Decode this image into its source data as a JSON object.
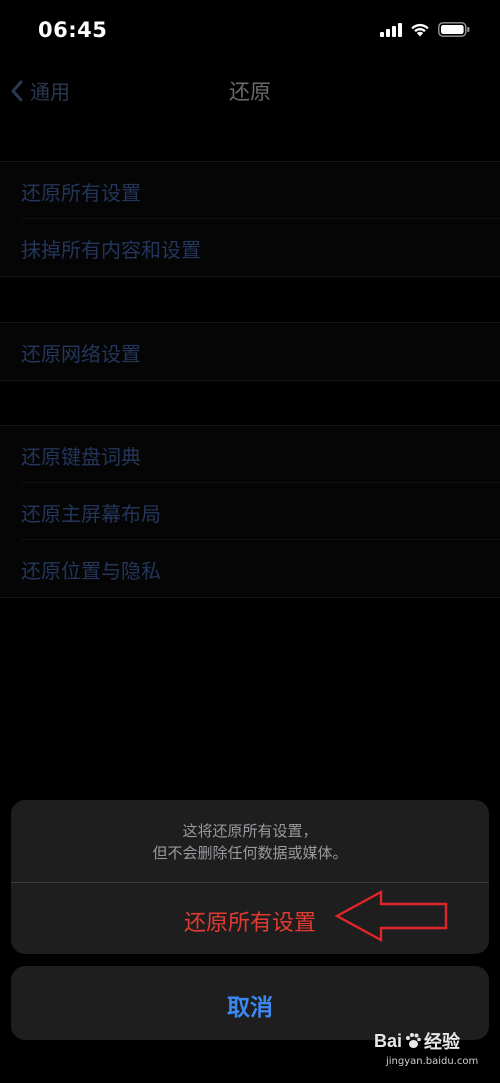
{
  "status_bar": {
    "time": "06:45",
    "icons": [
      "cellular-signal-icon",
      "wifi-icon",
      "battery-icon"
    ]
  },
  "nav": {
    "back_label": "通用",
    "title": "还原"
  },
  "groups": [
    {
      "items": [
        {
          "label": "还原所有设置"
        },
        {
          "label": "抹掉所有内容和设置"
        }
      ]
    },
    {
      "items": [
        {
          "label": "还原网络设置"
        }
      ]
    },
    {
      "items": [
        {
          "label": "还原键盘词典"
        },
        {
          "label": "还原主屏幕布局"
        },
        {
          "label": "还原位置与隐私"
        }
      ]
    }
  ],
  "action_sheet": {
    "message_line1": "这将还原所有设置，",
    "message_line2": "但不会删除任何数据或媒体。",
    "destructive_label": "还原所有设置",
    "cancel_label": "取消"
  },
  "watermark": {
    "brand": "Bai",
    "brand_suffix": "经验",
    "site": "jingyan.baidu.com"
  },
  "colors": {
    "background": "#000000",
    "sheet_background": "#1e1e1f",
    "destructive": "#e23a31",
    "cancel": "#3d88f0",
    "annotation_arrow": "#e0262b"
  }
}
